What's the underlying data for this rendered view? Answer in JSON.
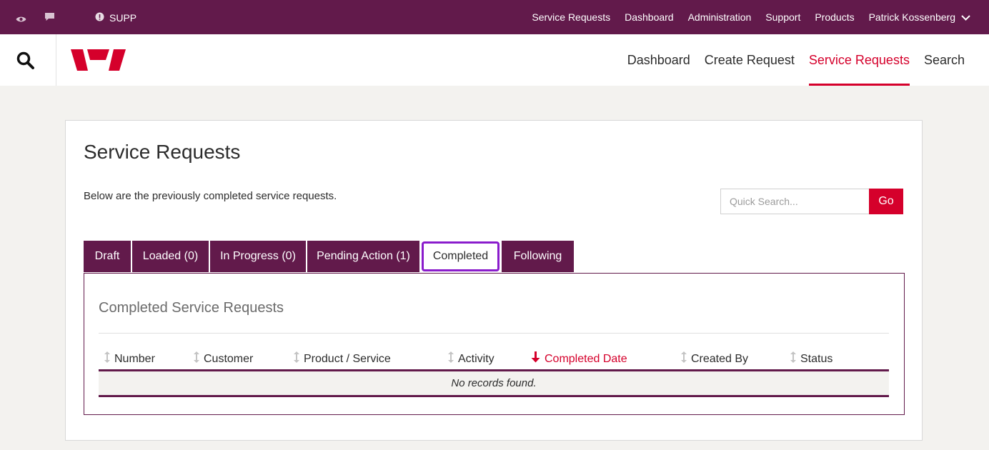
{
  "topbar": {
    "supp_label": "SUPP",
    "nav": [
      "Service Requests",
      "Dashboard",
      "Administration",
      "Support",
      "Products"
    ],
    "user": "Patrick Kossenberg"
  },
  "header": {
    "nav": [
      {
        "label": "Dashboard",
        "active": false
      },
      {
        "label": "Create Request",
        "active": false
      },
      {
        "label": "Service Requests",
        "active": true
      },
      {
        "label": "Search",
        "active": false
      }
    ]
  },
  "page": {
    "title": "Service Requests",
    "intro": "Below are the previously completed service requests.",
    "search_placeholder": "Quick Search...",
    "go_label": "Go"
  },
  "tabs": [
    {
      "label": "Draft",
      "active": false
    },
    {
      "label": "Loaded (0)",
      "active": false
    },
    {
      "label": "In Progress (0)",
      "active": false
    },
    {
      "label": "Pending Action (1)",
      "active": false
    },
    {
      "label": "Completed",
      "active": true
    },
    {
      "label": "Following",
      "active": false
    }
  ],
  "panel": {
    "title": "Completed Service Requests",
    "columns": [
      "Number",
      "Customer",
      "Product / Service",
      "Activity",
      "Completed Date",
      "Created By",
      "Status"
    ],
    "sorted_column": "Completed Date",
    "empty_message": "No records found."
  },
  "colors": {
    "brand_purple": "#621a4b",
    "accent_red": "#d5002b",
    "focus_outline": "#8a1ccc"
  }
}
